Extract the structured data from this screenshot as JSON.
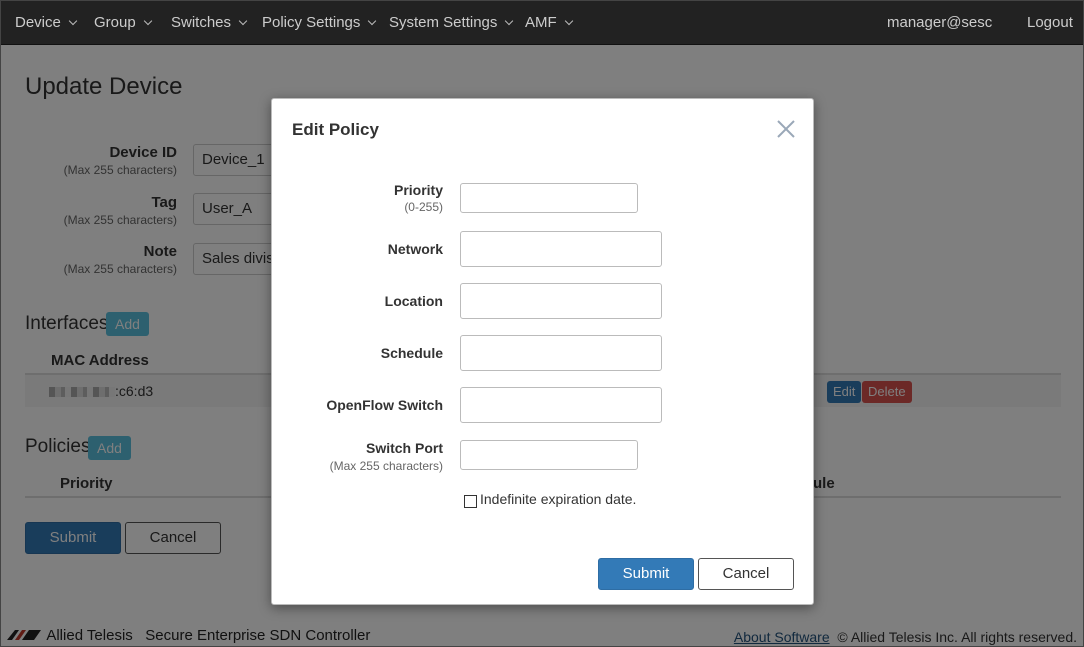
{
  "nav": {
    "items": [
      "Device",
      "Group",
      "Switches",
      "Policy Settings",
      "System Settings",
      "AMF"
    ],
    "user": "manager@sesc",
    "logout": "Logout"
  },
  "page": {
    "title": "Update Device",
    "fields": [
      {
        "label": "Device ID",
        "hint": "(Max 255 characters)",
        "value": "Device_1"
      },
      {
        "label": "Tag",
        "hint": "(Max 255 characters)",
        "value": "User_A"
      },
      {
        "label": "Note",
        "hint": "(Max 255 characters)",
        "value": "Sales divisi"
      }
    ],
    "interfaces": {
      "title": "Interfaces",
      "add": "Add",
      "header_mac": "MAC Address",
      "rows": [
        {
          "mac_suffix": ":c6:d3",
          "edit": "Edit",
          "delete": "Delete"
        }
      ]
    },
    "policies": {
      "title": "Policies",
      "add": "Add",
      "header_priority": "Priority",
      "header_schedule_partial": "ule"
    },
    "submit": "Submit",
    "cancel": "Cancel"
  },
  "footer": {
    "brand": "Allied Telesis",
    "product": "Secure Enterprise SDN Controller",
    "about": "About Software",
    "copyright": "© Allied Telesis Inc. All rights reserved."
  },
  "modal": {
    "title": "Edit Policy",
    "fields": [
      {
        "label": "Priority",
        "hint": "(0-255)",
        "value": ""
      },
      {
        "label": "Network",
        "hint": "",
        "value": ""
      },
      {
        "label": "Location",
        "hint": "",
        "value": ""
      },
      {
        "label": "Schedule",
        "hint": "",
        "value": ""
      },
      {
        "label": "OpenFlow Switch",
        "hint": "",
        "value": ""
      },
      {
        "label": "Switch Port",
        "hint": "(Max 255 characters)",
        "value": ""
      }
    ],
    "checkbox_label": "Indefinite expiration date.",
    "checkbox_checked": false,
    "submit": "Submit",
    "cancel": "Cancel"
  },
  "colors": {
    "navbar": "#222222",
    "primary": "#337ab7",
    "info": "#5bc0de",
    "danger": "#d9534f"
  }
}
